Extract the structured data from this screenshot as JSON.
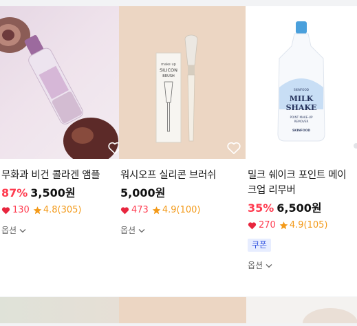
{
  "products": [
    {
      "title": "무화과 비건 콜라겐 앰플",
      "discount": "87%",
      "price": "3,500원",
      "likes": "130",
      "rating": "4.8(305)",
      "option_label": "옵션"
    },
    {
      "title": "워시오프 실리콘 브러쉬",
      "discount": "",
      "price": "5,000원",
      "likes": "473",
      "rating": "4.9(100)",
      "option_label": "옵션"
    },
    {
      "title_line1": "밀크 쉐이크 포인트 메이",
      "title_line2": "크업 리무버",
      "discount": "35%",
      "price": "6,500원",
      "likes": "270",
      "rating": "4.9(105)",
      "coupon": "쿠폰",
      "option_label": "옵션"
    }
  ],
  "product_images": {
    "box_brand": "make up",
    "box_title": "SILICON",
    "box_sub": "BRUSH",
    "bottle_brand": "SKINFOOD",
    "bottle_title1": "MILK",
    "bottle_title2": "SHAKE",
    "bottle_sub1": "POINT MAKE-UP",
    "bottle_sub2": "REMOVER",
    "bottle_logo": "SKINFOOD"
  },
  "colors": {
    "accent_red": "#ff3b4f",
    "star_orange": "#f39a1a",
    "coupon_blue": "#3556e0"
  }
}
